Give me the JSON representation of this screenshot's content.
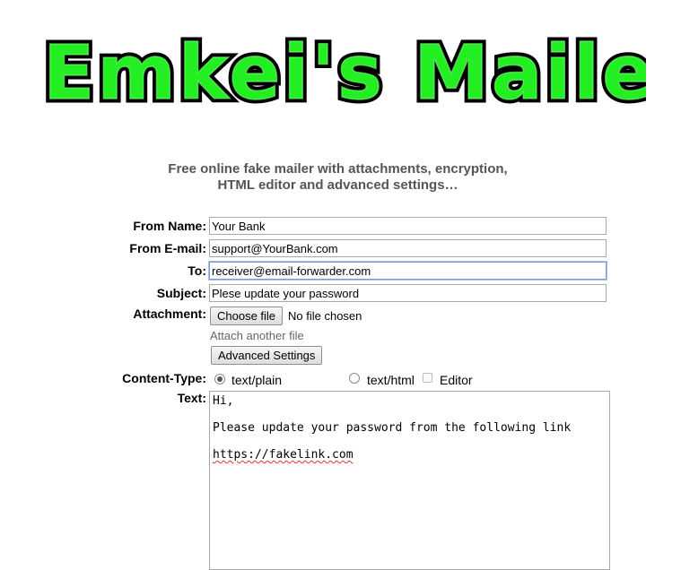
{
  "logo": {
    "text": "Emkei's Mailer"
  },
  "tagline": {
    "line1": "Free online fake mailer with attachments, encryption,",
    "line2": "HTML editor and advanced settings…"
  },
  "form": {
    "from_name_label": "From Name:",
    "from_name_value": "Your Bank",
    "from_email_label": "From E-mail:",
    "from_email_value": "support@YourBank.com",
    "to_label": "To:",
    "to_value": "receiver@email-forwarder.com",
    "subject_label": "Subject:",
    "subject_value": "Plese update your password",
    "attachment_label": "Attachment:",
    "choose_file_label": "Choose file",
    "no_file_text": "No file chosen",
    "attach_another_label": "Attach another file",
    "advanced_settings_label": "Advanced Settings",
    "content_type_label": "Content-Type:",
    "content_type_options": [
      {
        "label": "text/plain",
        "selected": true
      },
      {
        "label": "text/html",
        "selected": false
      }
    ],
    "editor_label": "Editor",
    "editor_checked": false,
    "text_label": "Text:",
    "text_lines": [
      "Hi,",
      "Please update your password from the following link",
      "https://fakelink.com"
    ]
  },
  "colors": {
    "logo_fill": "#22ee22",
    "logo_stroke": "#000000",
    "tagline": "#555555",
    "focus_border": "#7a9cd3",
    "link_muted": "#666666"
  }
}
